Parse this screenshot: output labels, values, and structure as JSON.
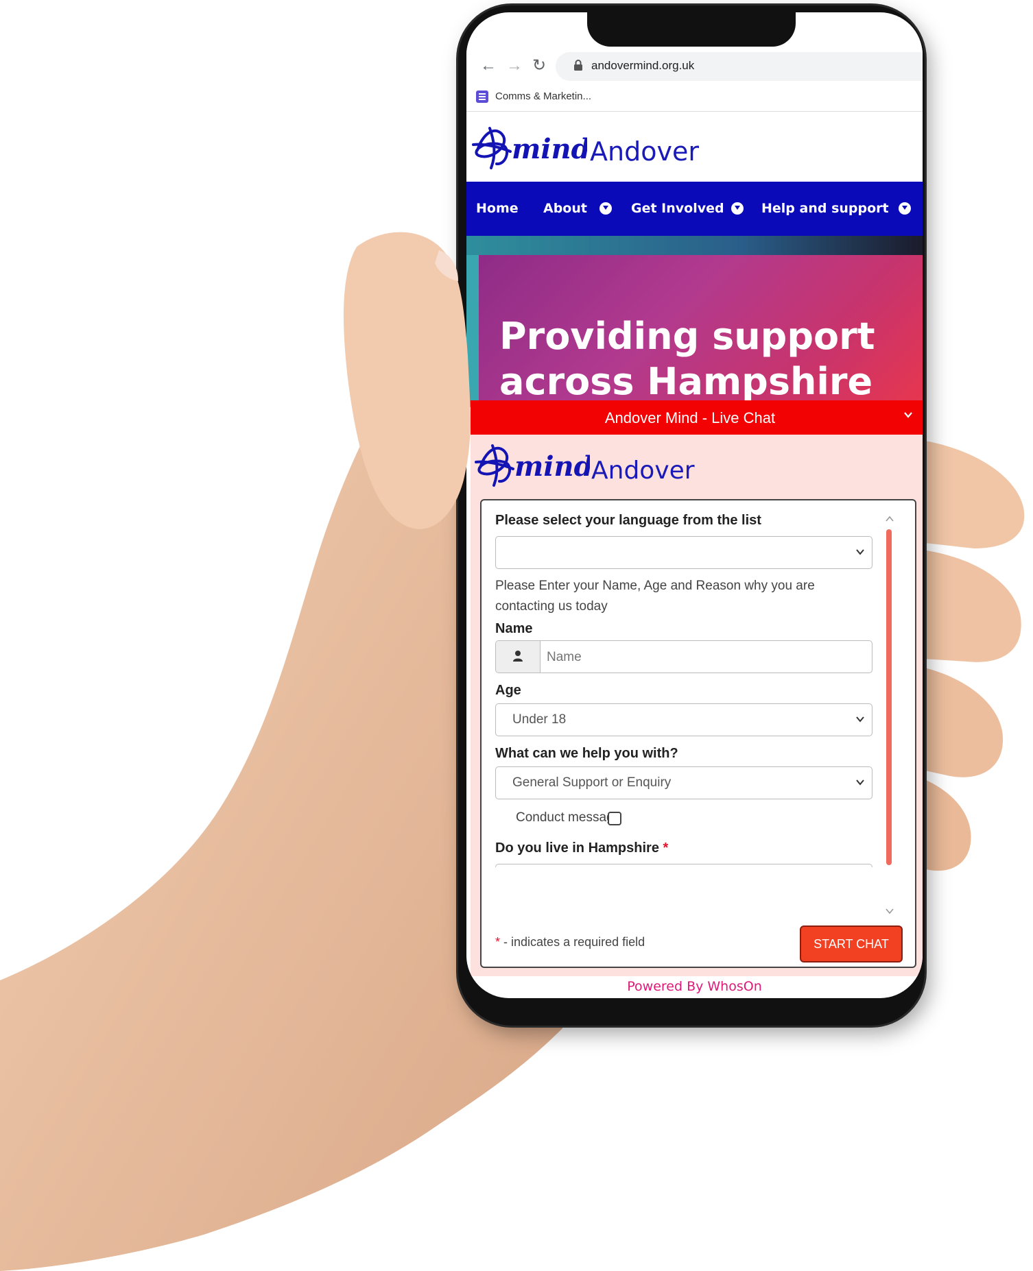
{
  "browser": {
    "url": "andovermind.org.uk",
    "bookmark": "Comms & Marketin..."
  },
  "site": {
    "logo_text": "Andover",
    "nav": [
      {
        "label": "Home"
      },
      {
        "label": "About"
      },
      {
        "label": "Get Involved"
      },
      {
        "label": "Help and support"
      }
    ],
    "hero_line1": "Providing support",
    "hero_line2": "across Hampshire"
  },
  "chat": {
    "title": "Andover Mind - Live Chat",
    "logo_text": "Andover",
    "language_label": "Please select your language from the list",
    "language_value": "",
    "instructions": "Please Enter your Name, Age and Reason why you are contacting us today",
    "name_label": "Name",
    "name_placeholder": "Name",
    "age_label": "Age",
    "age_value": "Under 18",
    "help_label": "What can we help you with?",
    "help_value": "General Support or Enquiry",
    "conduct_label": "Conduct message",
    "hampshire_label": "Do you live in Hampshire",
    "required_marker": "*",
    "required_note": "- indicates a required field",
    "start_button": "START CHAT",
    "powered_by": "Powered By WhosOn"
  },
  "colors": {
    "nav_bg": "#0a0ab8",
    "chat_header": "#f20202",
    "chat_bg": "#fde1df",
    "start_button": "#f24022",
    "powered_by": "#e0187a"
  }
}
